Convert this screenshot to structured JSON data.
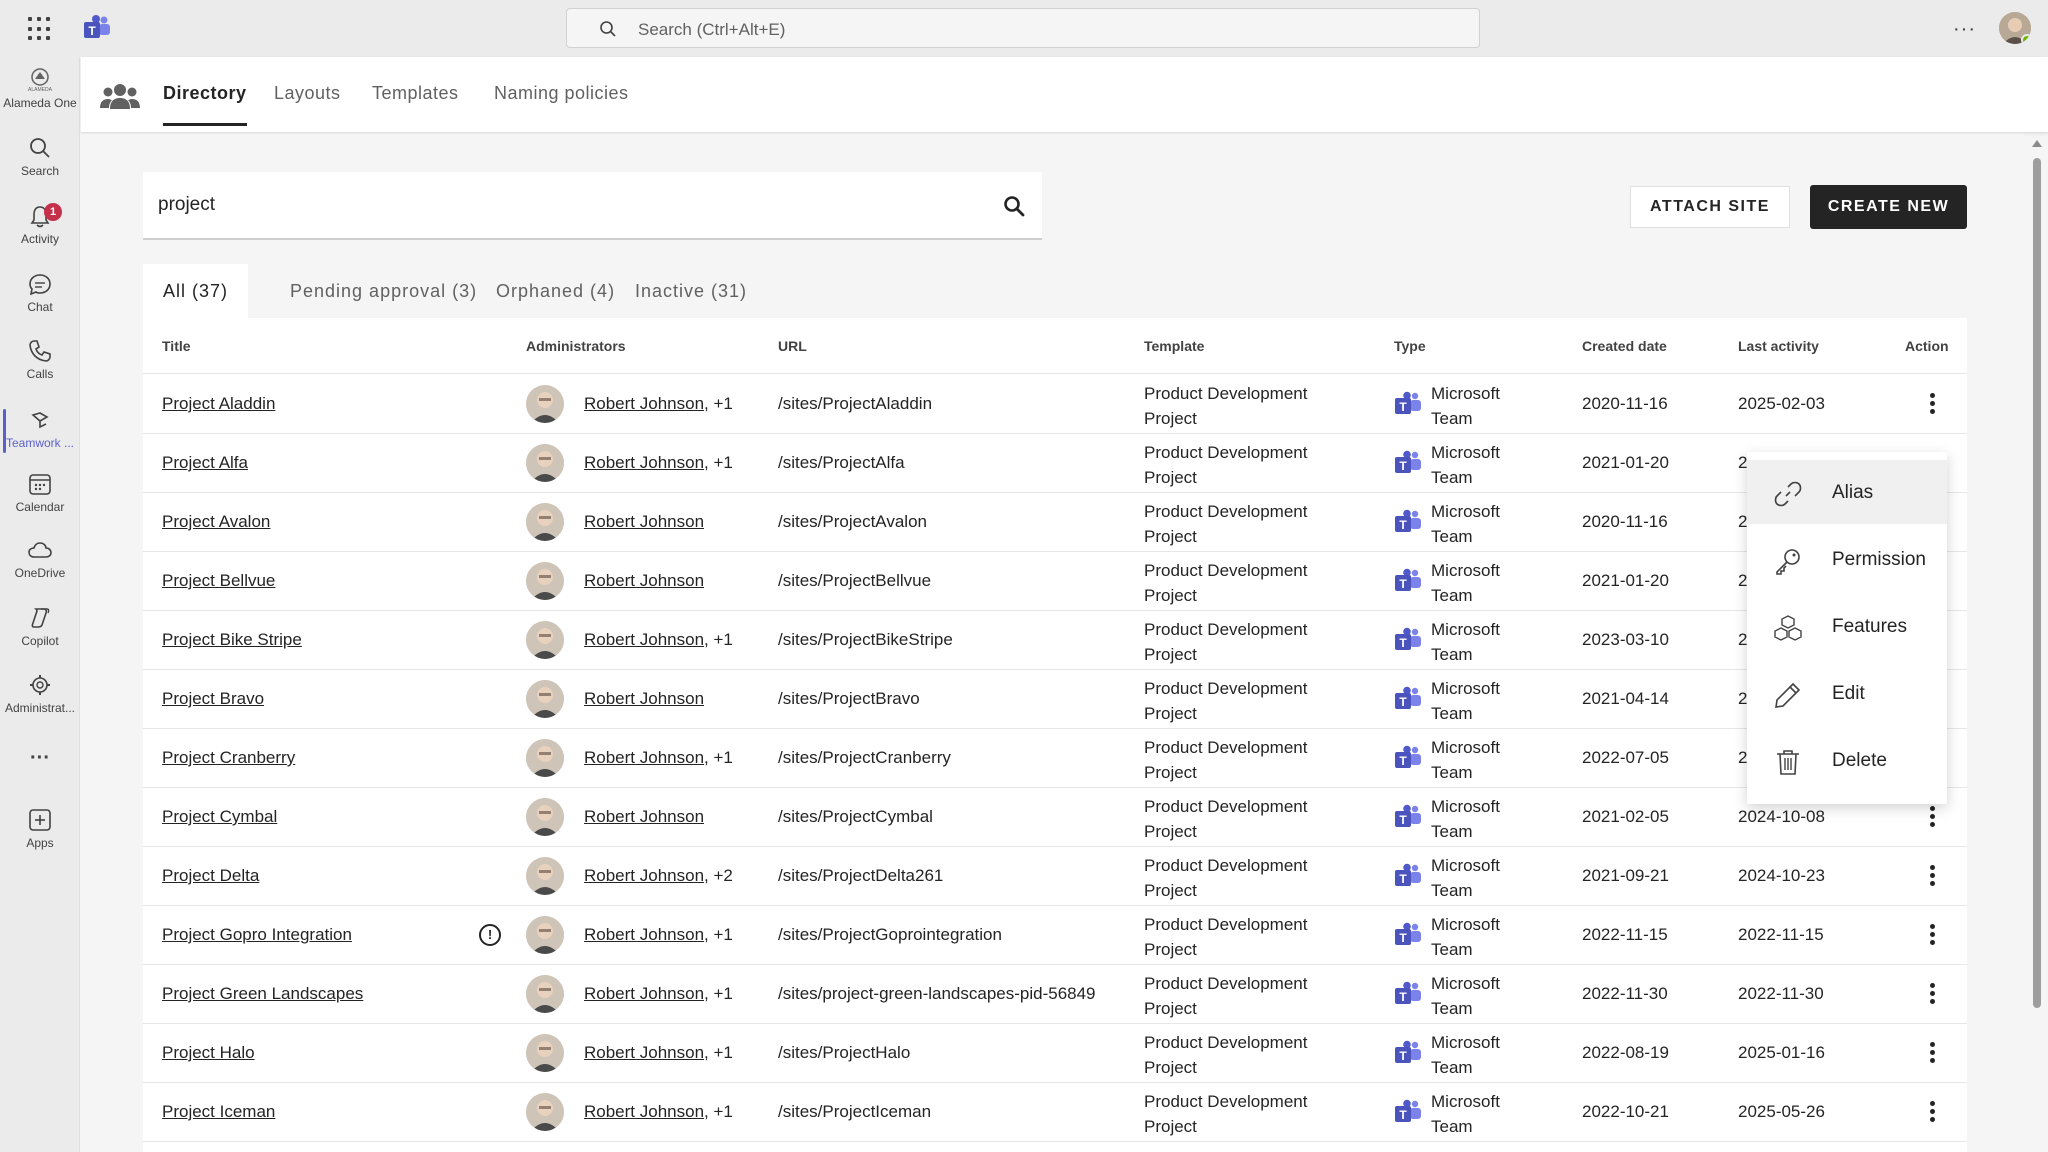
{
  "topbar": {
    "search_placeholder": "Search (Ctrl+Alt+E)",
    "more": "···"
  },
  "rail": {
    "items": [
      {
        "label": "Alameda One",
        "icon": "org-logo-icon"
      },
      {
        "label": "Search",
        "icon": "search-icon"
      },
      {
        "label": "Activity",
        "icon": "bell-icon",
        "badge": "1"
      },
      {
        "label": "Chat",
        "icon": "chat-icon"
      },
      {
        "label": "Calls",
        "icon": "phone-icon"
      },
      {
        "label": "Teamwork ...",
        "icon": "teamwork-icon"
      },
      {
        "label": "Calendar",
        "icon": "calendar-icon"
      },
      {
        "label": "OneDrive",
        "icon": "cloud-icon"
      },
      {
        "label": "Copilot",
        "icon": "copilot-icon"
      },
      {
        "label": "Administrat...",
        "icon": "admin-icon"
      },
      {
        "label": "···",
        "icon": "more-icon"
      },
      {
        "label": "Apps",
        "icon": "apps-icon"
      }
    ]
  },
  "app_tabs": [
    "Directory",
    "Layouts",
    "Templates",
    "Naming policies"
  ],
  "search": {
    "value": "project"
  },
  "buttons": {
    "attach": "ATTACH SITE",
    "create": "CREATE NEW"
  },
  "filters": [
    "All (37)",
    "Pending approval (3)",
    "Orphaned (4)",
    "Inactive (31)"
  ],
  "table": {
    "headers": [
      "Title",
      "Administrators",
      "URL",
      "Template",
      "Type",
      "Created date",
      "Last activity",
      "Action"
    ],
    "rows": [
      {
        "title": "Project Aladdin",
        "admin": "Robert Johnson",
        "extra": ", +1",
        "url": "/sites/ProjectAladdin",
        "tpl1": "Product Development",
        "tpl2": "Project",
        "type1": "Microsoft",
        "type2": "Team",
        "created": "2020-11-16",
        "last": "2025-02-03"
      },
      {
        "title": "Project Alfa",
        "admin": "Robert Johnson",
        "extra": ", +1",
        "url": "/sites/ProjectAlfa",
        "tpl1": "Product Development",
        "tpl2": "Project",
        "type1": "Microsoft",
        "type2": "Team",
        "created": "2021-01-20",
        "last": "2"
      },
      {
        "title": "Project Avalon",
        "admin": "Robert Johnson",
        "extra": "",
        "url": "/sites/ProjectAvalon",
        "tpl1": "Product Development",
        "tpl2": "Project",
        "type1": "Microsoft",
        "type2": "Team",
        "created": "2020-11-16",
        "last": "2"
      },
      {
        "title": "Project Bellvue",
        "admin": "Robert Johnson",
        "extra": "",
        "url": "/sites/ProjectBellvue",
        "tpl1": "Product Development",
        "tpl2": "Project",
        "type1": "Microsoft",
        "type2": "Team",
        "created": "2021-01-20",
        "last": "2"
      },
      {
        "title": "Project Bike Stripe",
        "admin": "Robert Johnson",
        "extra": ", +1",
        "url": "/sites/ProjectBikeStripe",
        "tpl1": "Product Development",
        "tpl2": "Project",
        "type1": "Microsoft",
        "type2": "Team",
        "created": "2023-03-10",
        "last": "2"
      },
      {
        "title": "Project Bravo",
        "admin": "Robert Johnson",
        "extra": "",
        "url": "/sites/ProjectBravo",
        "tpl1": "Product Development",
        "tpl2": "Project",
        "type1": "Microsoft",
        "type2": "Team",
        "created": "2021-04-14",
        "last": "2"
      },
      {
        "title": "Project Cranberry",
        "admin": "Robert Johnson",
        "extra": ", +1",
        "url": "/sites/ProjectCranberry",
        "tpl1": "Product Development",
        "tpl2": "Project",
        "type1": "Microsoft",
        "type2": "Team",
        "created": "2022-07-05",
        "last": "2"
      },
      {
        "title": "Project Cymbal",
        "admin": "Robert Johnson",
        "extra": "",
        "url": "/sites/ProjectCymbal",
        "tpl1": "Product Development",
        "tpl2": "Project",
        "type1": "Microsoft",
        "type2": "Team",
        "created": "2021-02-05",
        "last": "2024-10-08"
      },
      {
        "title": "Project Delta",
        "admin": "Robert Johnson",
        "extra": ", +2",
        "url": "/sites/ProjectDelta261",
        "tpl1": "Product Development",
        "tpl2": "Project",
        "type1": "Microsoft",
        "type2": "Team",
        "created": "2021-09-21",
        "last": "2024-10-23"
      },
      {
        "title": "Project Gopro Integration",
        "admin": "Robert Johnson",
        "extra": ", +1",
        "url": "/sites/ProjectGoprointegration",
        "tpl1": "Product Development",
        "tpl2": "Project",
        "type1": "Microsoft",
        "type2": "Team",
        "created": "2022-11-15",
        "last": "2022-11-15",
        "info": "!"
      },
      {
        "title": "Project Green Landscapes",
        "admin": "Robert Johnson",
        "extra": ", +1",
        "url": "/sites/project-green-landscapes-pid-56849",
        "tpl1": "Product Development",
        "tpl2": "Project",
        "type1": "Microsoft",
        "type2": "Team",
        "created": "2022-11-30",
        "last": "2022-11-30"
      },
      {
        "title": "Project Halo",
        "admin": "Robert Johnson",
        "extra": ", +1",
        "url": "/sites/ProjectHalo",
        "tpl1": "Product Development",
        "tpl2": "Project",
        "type1": "Microsoft",
        "type2": "Team",
        "created": "2022-08-19",
        "last": "2025-01-16"
      },
      {
        "title": "Project Iceman",
        "admin": "Robert Johnson",
        "extra": ", +1",
        "url": "/sites/ProjectIceman",
        "tpl1": "Product Development",
        "tpl2": "Project",
        "type1": "Microsoft",
        "type2": "Team",
        "created": "2022-10-21",
        "last": "2025-05-26"
      }
    ]
  },
  "context_menu": {
    "items": [
      "Alias",
      "Permission",
      "Features",
      "Edit",
      "Delete"
    ]
  },
  "colors": {
    "accent": "#5b5fc7",
    "teams_purple": "#5b5fc7",
    "badge": "#c4314b",
    "presence": "#6bb700"
  }
}
